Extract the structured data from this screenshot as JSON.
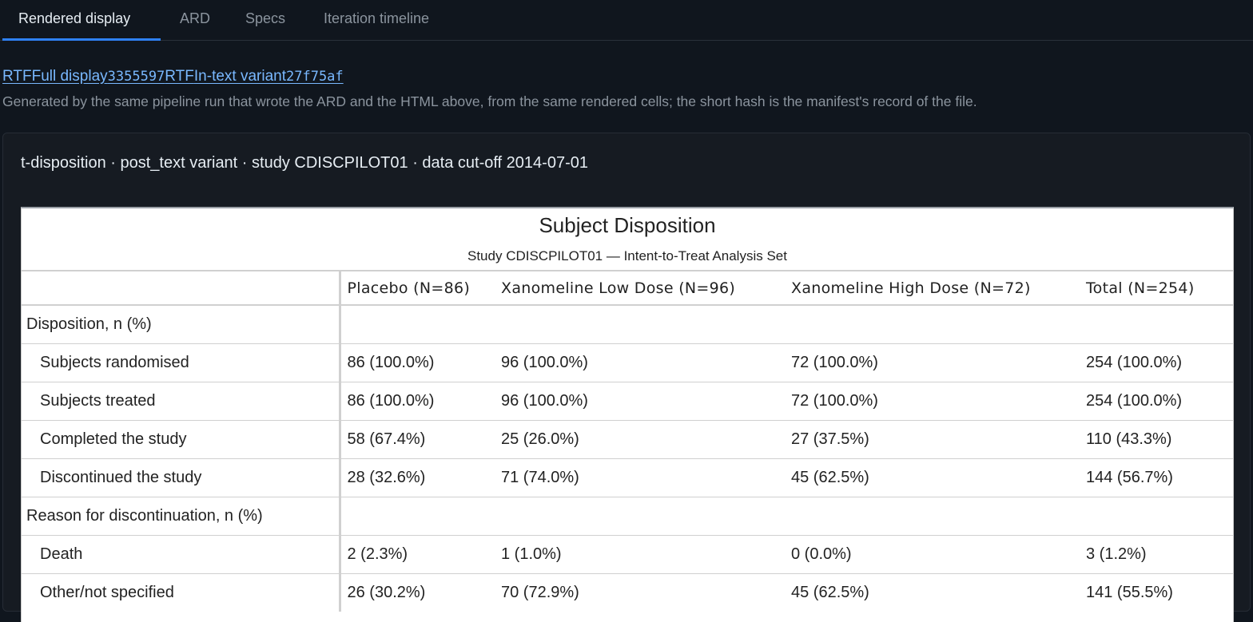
{
  "tabs": [
    {
      "label": "Rendered display",
      "active": true
    },
    {
      "label": "ARD",
      "active": false
    },
    {
      "label": "Specs",
      "active": false
    },
    {
      "label": "Iteration timeline",
      "active": false
    }
  ],
  "rtf_links": [
    {
      "format": "RTF",
      "label": "Full display",
      "hash": "3355597"
    },
    {
      "format": "RTF",
      "label": "In-text variant",
      "hash": "27f75af"
    }
  ],
  "caption": "Generated by the same pipeline run that wrote the ARD and the HTML above, from the same rendered cells; the short hash is the manifest's record of the file.",
  "panel_heading": "t-disposition · post_text variant · study CDISCPILOT01 · data cut-off 2014-07-01",
  "table": {
    "title": "Subject Disposition",
    "subtitle": "Study CDISCPILOT01 — Intent-to-Treat Analysis Set",
    "columns": [
      "",
      "Placebo (N=86)",
      "Xanomeline Low Dose (N=96)",
      "Xanomeline High Dose (N=72)",
      "Total (N=254)"
    ],
    "rows": [
      {
        "type": "group",
        "label": "Disposition, n (%)",
        "values": []
      },
      {
        "type": "item",
        "label": "Subjects randomised",
        "values": [
          "86 (100.0%)",
          "96 (100.0%)",
          "72 (100.0%)",
          "254 (100.0%)"
        ]
      },
      {
        "type": "item",
        "label": "Subjects treated",
        "values": [
          "86 (100.0%)",
          "96 (100.0%)",
          "72 (100.0%)",
          "254 (100.0%)"
        ]
      },
      {
        "type": "item",
        "label": "Completed the study",
        "values": [
          "58 (67.4%)",
          "25 (26.0%)",
          "27 (37.5%)",
          "110 (43.3%)"
        ]
      },
      {
        "type": "item",
        "label": "Discontinued the study",
        "values": [
          "28 (32.6%)",
          "71 (74.0%)",
          "45 (62.5%)",
          "144 (56.7%)"
        ]
      },
      {
        "type": "group",
        "label": "Reason for discontinuation, n (%)",
        "values": []
      },
      {
        "type": "item",
        "label": "Death",
        "values": [
          "2 (2.3%)",
          "1 (1.0%)",
          "0 (0.0%)",
          "3 (1.2%)"
        ]
      },
      {
        "type": "item",
        "label": "Other/not specified",
        "values": [
          "26 (30.2%)",
          "70 (72.9%)",
          "45 (62.5%)",
          "141 (55.5%)"
        ]
      }
    ]
  }
}
